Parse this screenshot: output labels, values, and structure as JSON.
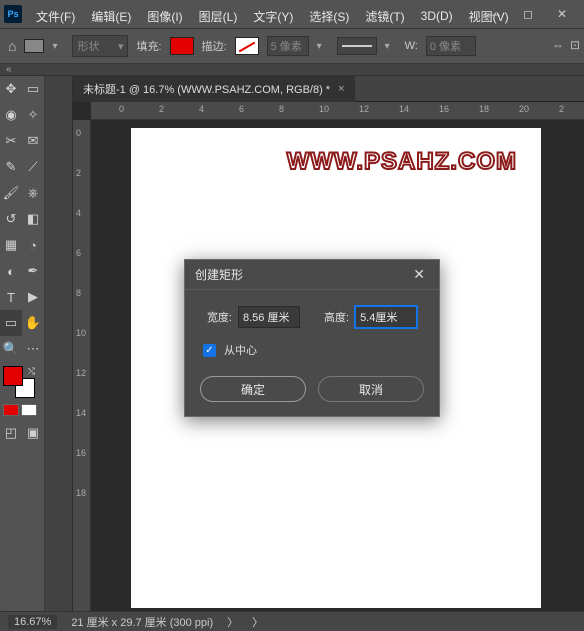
{
  "menu": {
    "file": "文件(F)",
    "edit": "编辑(E)",
    "image": "图像(I)",
    "layer": "图层(L)",
    "type": "文字(Y)",
    "select": "选择(S)",
    "filter": "滤镜(T)",
    "threeD": "3D(D)",
    "view": "视图(V)"
  },
  "options": {
    "shape": "形状",
    "fill": "填充:",
    "stroke": "描边:",
    "strokeVal": "5 像素",
    "w_label": "W:",
    "w_val": "0 像素"
  },
  "tab": {
    "title": "未标题-1 @ 16.7% (WWW.PSAHZ.COM, RGB/8) *"
  },
  "watermark": "WWW.PSAHZ.COM",
  "ruler_h": [
    "0",
    "2",
    "4",
    "6",
    "8",
    "10",
    "12",
    "14",
    "16",
    "18",
    "20",
    "2"
  ],
  "ruler_v": [
    "0",
    "2",
    "4",
    "6",
    "8",
    "10",
    "12",
    "14",
    "16",
    "18"
  ],
  "status": {
    "zoom": "16.67%",
    "info": "21 厘米 x 29.7 厘米 (300 ppi)",
    "arrow": "〉",
    "arrow2": "〉"
  },
  "dialog": {
    "title": "创建矩形",
    "width_label": "宽度:",
    "width_val": "8.56 厘米",
    "height_label": "高度:",
    "height_val": "5.4厘米",
    "center": "从中心",
    "ok": "确定",
    "cancel": "取消"
  },
  "colors": {
    "fg": "#e30000",
    "bg": "#ffffff"
  },
  "chart_data": null
}
